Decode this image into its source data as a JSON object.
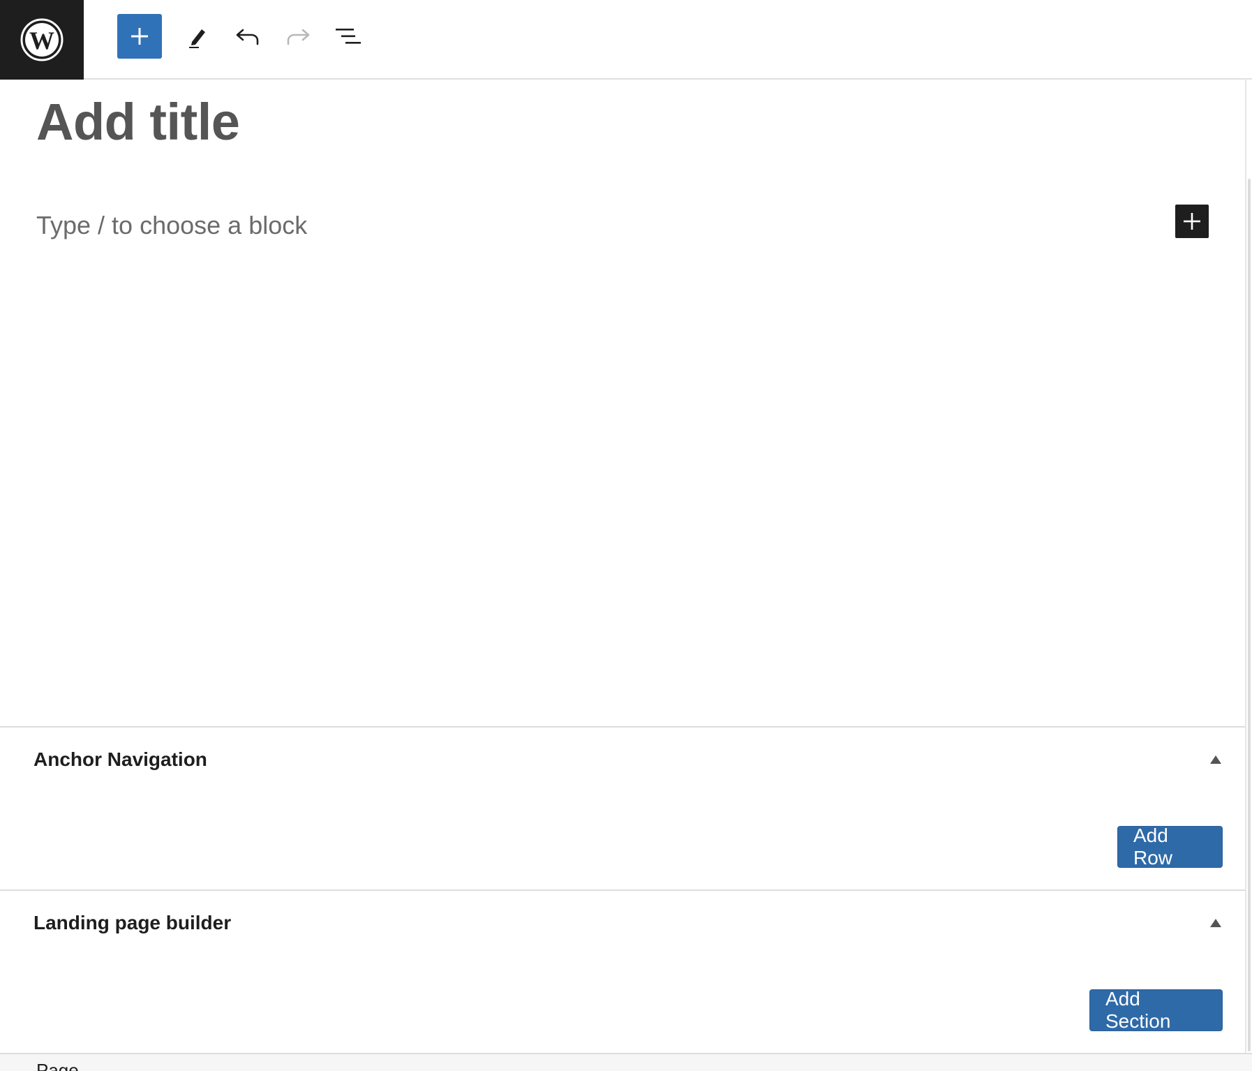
{
  "toolbar": {
    "logo_icon": "wordpress-logo-icon",
    "inserter_icon": "plus-icon",
    "tools_icon": "pencil-icon",
    "undo_icon": "undo-icon",
    "redo_icon": "redo-icon",
    "list_view_icon": "list-view-icon",
    "accent_color": "#2f72b7"
  },
  "editor": {
    "title_placeholder": "Add title",
    "block_placeholder": "Type / to choose a block",
    "inline_inserter_icon": "plus-icon"
  },
  "metaboxes": [
    {
      "title": "Anchor Navigation",
      "toggle_icon": "triangle-up-icon",
      "button_label": "Add Row"
    },
    {
      "title": "Landing page builder",
      "toggle_icon": "triangle-up-icon",
      "button_label": "Add Section"
    }
  ],
  "footer": {
    "breadcrumb": "Page"
  },
  "colors": {
    "button_blue": "#2f6aa8",
    "dark": "#1e1e1e"
  }
}
